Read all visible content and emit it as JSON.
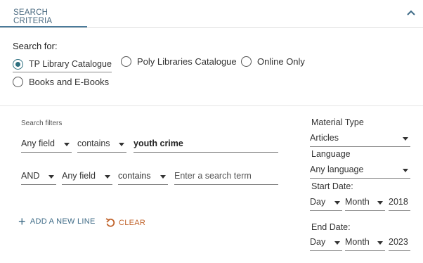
{
  "tab": {
    "label": "SEARCH CRITERIA"
  },
  "search_for": {
    "label": "Search for:",
    "options": [
      {
        "label": "TP Library Catalogue",
        "selected": true
      },
      {
        "label": "Poly Libraries Catalogue",
        "selected": false
      },
      {
        "label": "Online Only",
        "selected": false
      },
      {
        "label": "Books and E-Books",
        "selected": false
      }
    ]
  },
  "filters": {
    "label": "Search filters",
    "row1": {
      "field": "Any field",
      "operator": "contains",
      "value": "youth crime"
    },
    "row2": {
      "boolean": "AND",
      "field": "Any field",
      "operator": "contains",
      "placeholder": "Enter a search term"
    }
  },
  "actions": {
    "add_line": "ADD A NEW LINE",
    "clear": "CLEAR"
  },
  "material_type": {
    "label": "Material Type",
    "value": "Articles"
  },
  "language": {
    "label": "Language",
    "value": "Any language"
  },
  "start_date": {
    "label": "Start Date:",
    "day": "Day",
    "month": "Month",
    "year": "2018"
  },
  "end_date": {
    "label": "End Date:",
    "day": "Day",
    "month": "Month",
    "year": "2023"
  },
  "colors": {
    "accent": "#2d6f7f",
    "tab_underline": "#4a7a9a",
    "link": "#3d6a86",
    "clear": "#c0622a"
  }
}
